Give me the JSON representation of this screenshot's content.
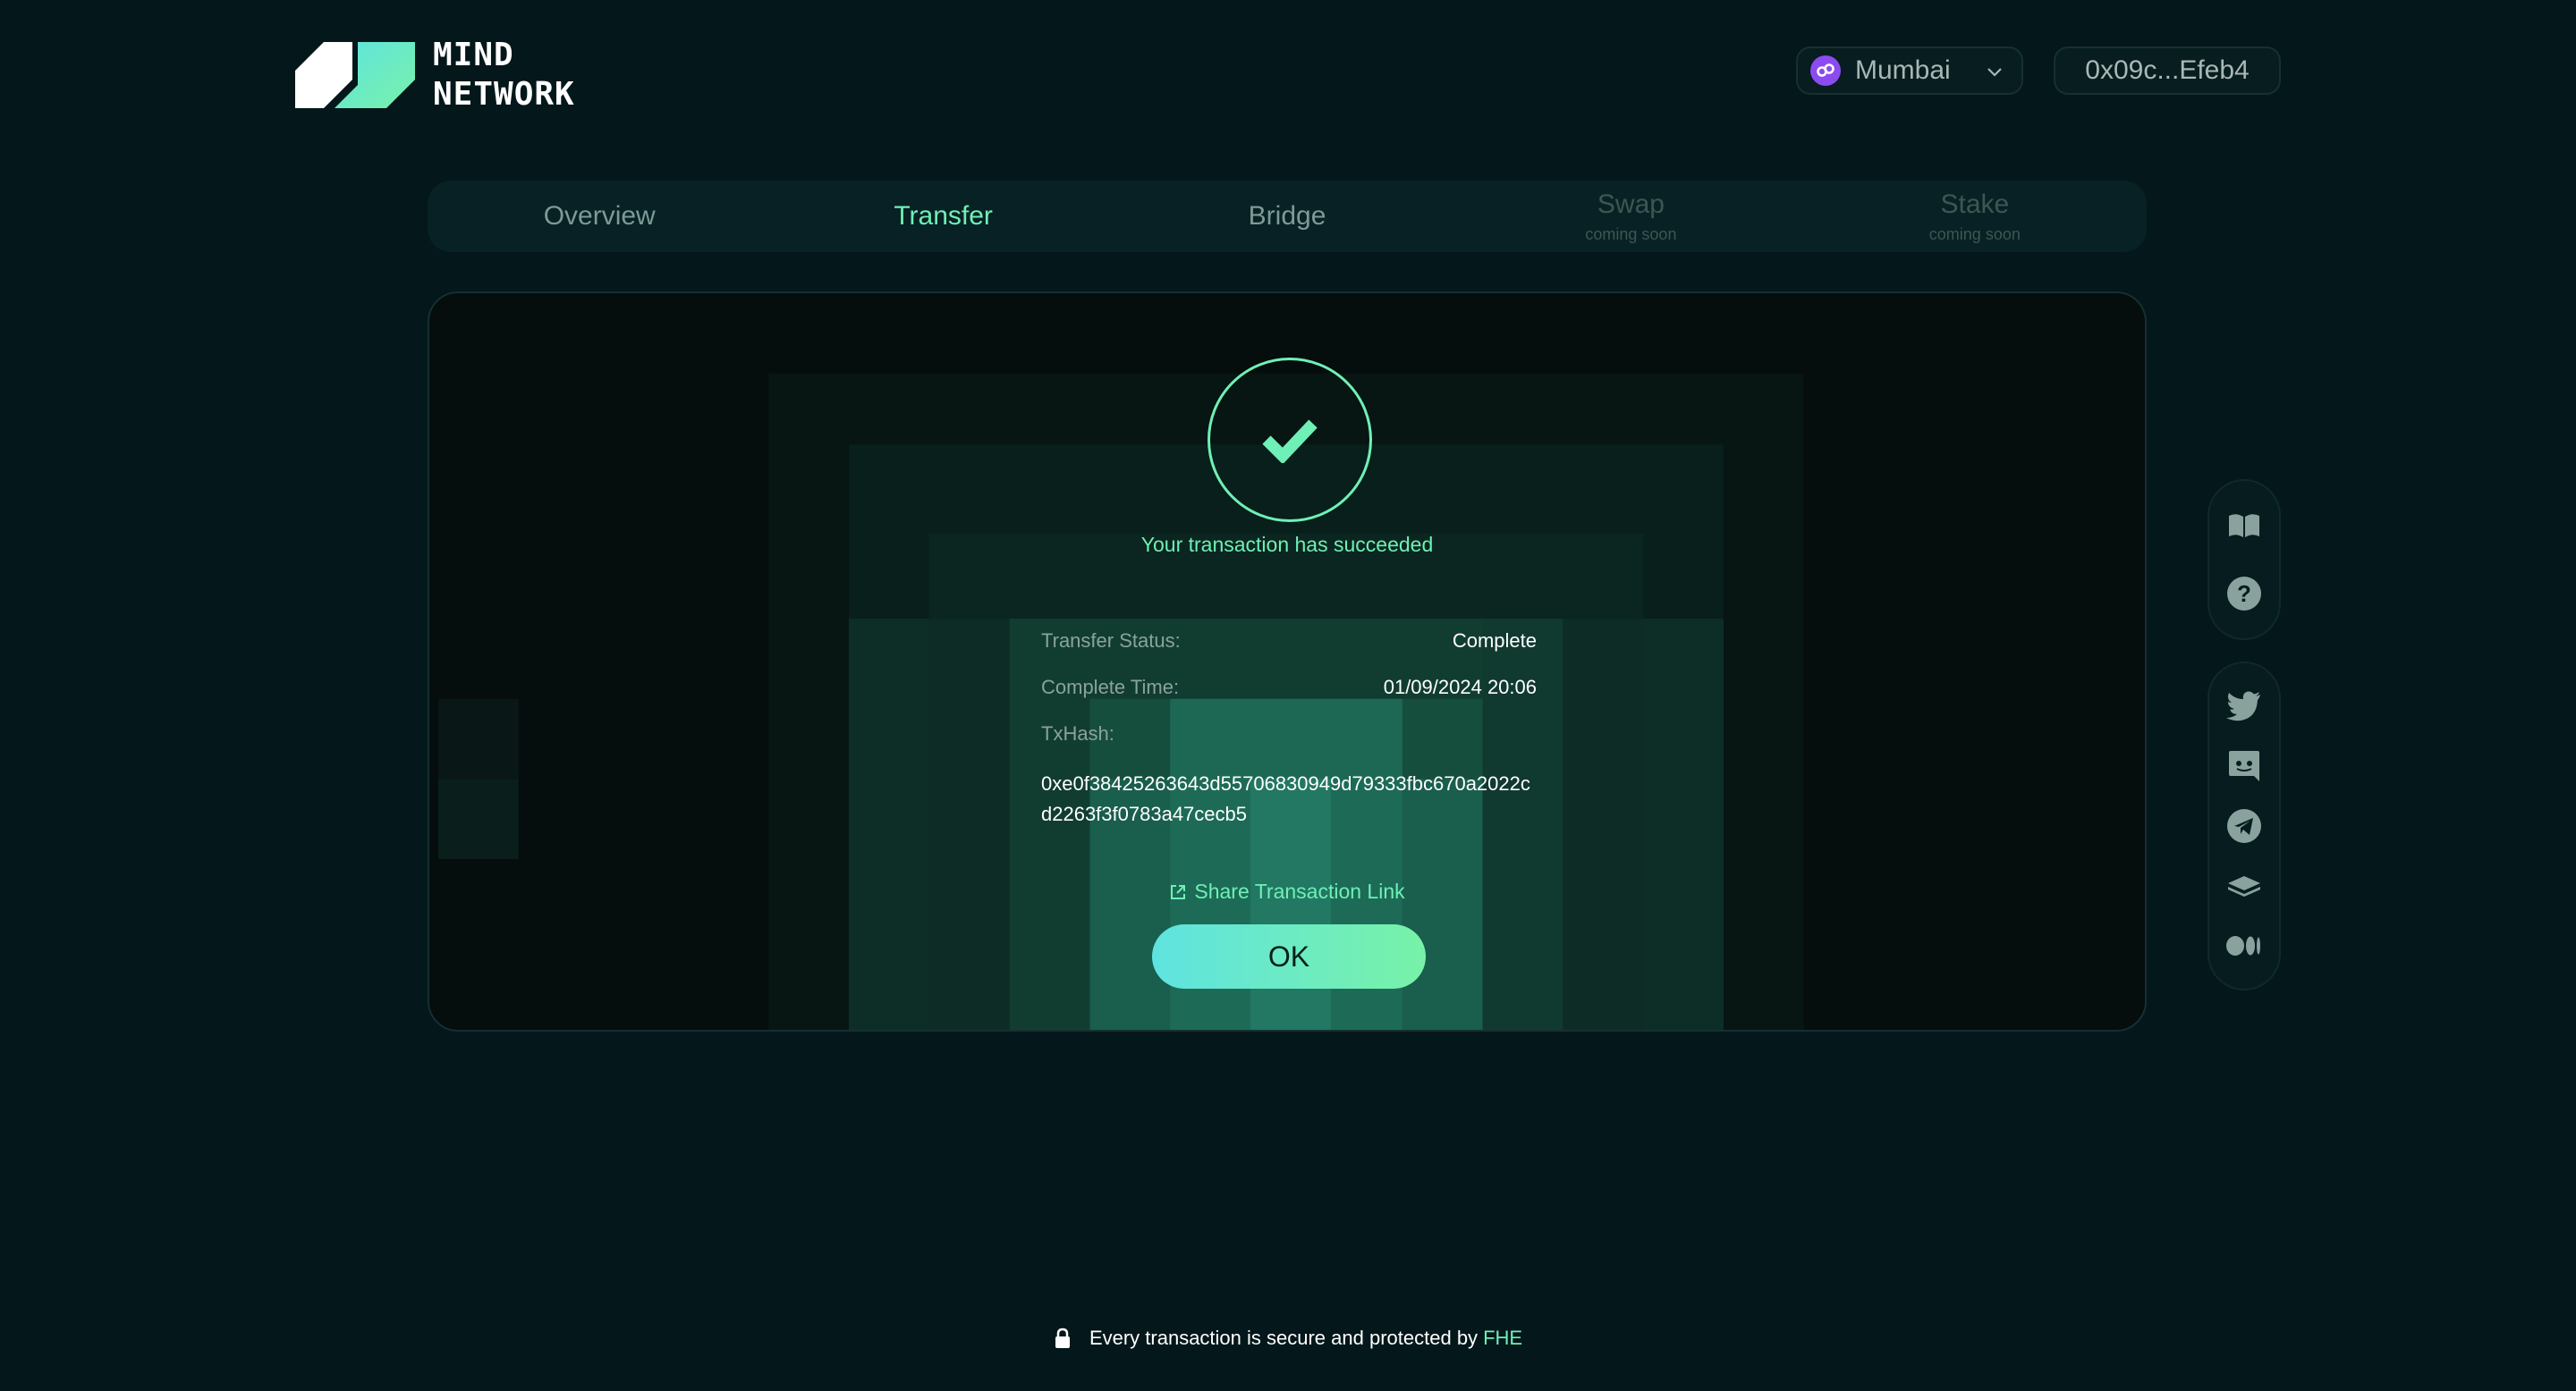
{
  "brand": {
    "line1": "MIND",
    "line2": "NETWORK"
  },
  "header": {
    "network": {
      "label": "Mumbai",
      "icon": "polygon-icon"
    },
    "wallet": {
      "address": "0x09c...Efeb4"
    }
  },
  "tabs": [
    {
      "label": "Overview",
      "sub": "",
      "state": "normal"
    },
    {
      "label": "Transfer",
      "sub": "",
      "state": "active"
    },
    {
      "label": "Bridge",
      "sub": "",
      "state": "normal"
    },
    {
      "label": "Swap",
      "sub": "coming soon",
      "state": "disabled"
    },
    {
      "label": "Stake",
      "sub": "coming soon",
      "state": "disabled"
    }
  ],
  "result": {
    "message": "Your transaction has succeeded",
    "status_label": "Transfer Status:",
    "status_value": "Complete",
    "time_label": "Complete Time:",
    "time_value": "01/09/2024 20:06",
    "hash_label": "TxHash:",
    "hash_value": "0xe0f38425263643d55706830949d79333fbc670a2022cd2263f3f0783a47cecb5",
    "share_label": "Share Transaction Link",
    "ok_label": "OK"
  },
  "side_rail": {
    "top": [
      "docs-book-icon",
      "help-icon"
    ],
    "bottom": [
      "twitter-icon",
      "discord-icon",
      "telegram-icon",
      "gitbook-icon",
      "medium-icon"
    ]
  },
  "footer": {
    "text": "Every transaction is secure and protected by",
    "highlight": "FHE"
  },
  "colors": {
    "background": "#04171a",
    "accent": "#6ff0b6",
    "button_gradient_start": "#5fe3e0",
    "button_gradient_end": "#78f2a8",
    "network_icon": "#8c4bf0"
  }
}
